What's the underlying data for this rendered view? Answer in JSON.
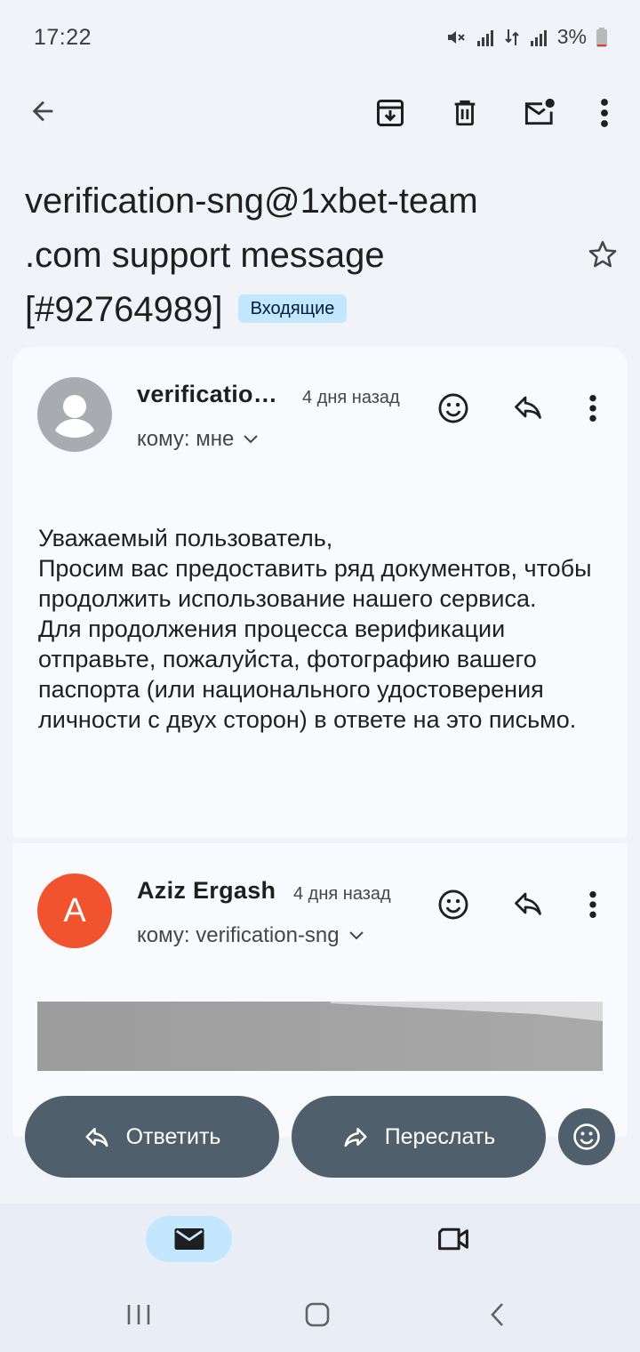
{
  "status_bar": {
    "time": "17:22",
    "battery": "3%"
  },
  "email": {
    "subject": "verification-sng@1xbet-team .com support message [#92764989]",
    "label": "Входящие"
  },
  "messages": [
    {
      "sender": "verificatio…",
      "time": "4 дня назад",
      "recipient": "кому: мне",
      "avatar_letter": "",
      "body": [
        "Уважаемый пользователь,",
        "Просим вас предоставить ряд документов, чтобы продолжить использование нашего сервиса.",
        "Для продолжения процесса верификации отправьте, пожалуйста, фотографию вашего паспорта (или национального удостоверения личности с двух сторон) в ответе на это письмо."
      ]
    },
    {
      "sender": "Aziz Ergash",
      "time": "4 дня назад",
      "recipient": "кому: verification-sng",
      "avatar_letter": "A"
    }
  ],
  "actions": {
    "reply_label": "Ответить",
    "forward_label": "Переслать"
  },
  "colors": {
    "accent": "#c2e7ff",
    "button": "#4f5f6b",
    "avatar_orange": "#f0532d"
  }
}
